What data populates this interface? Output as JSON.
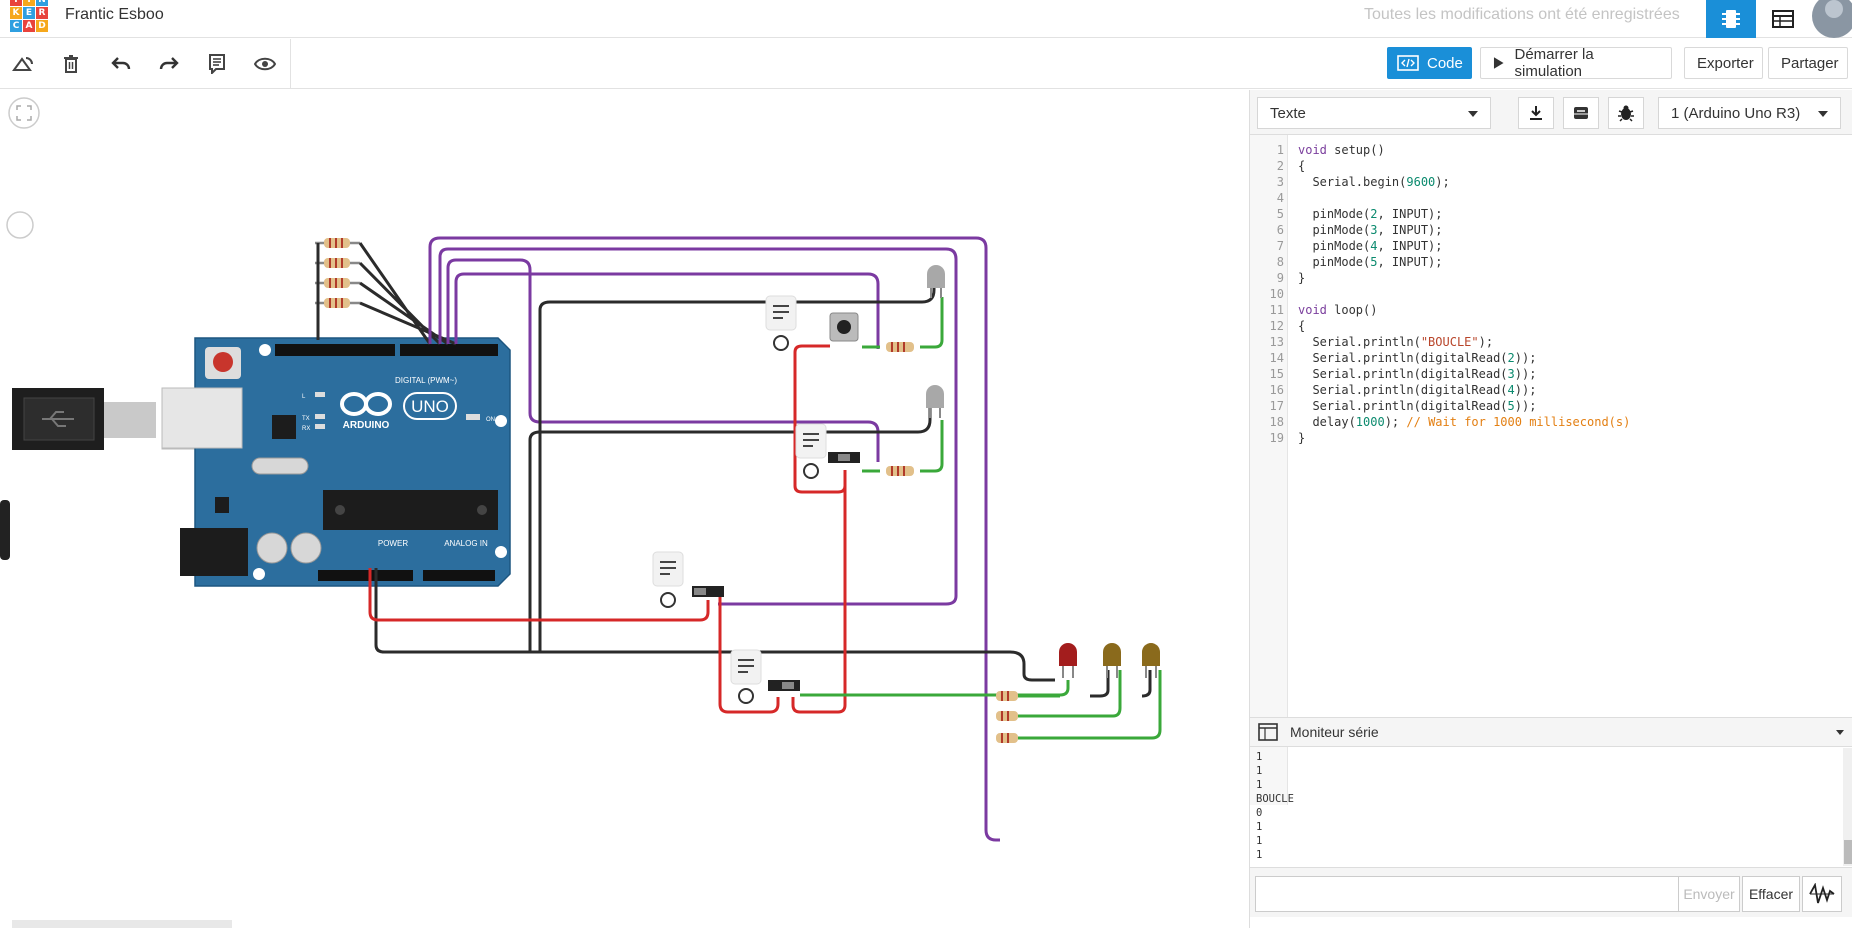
{
  "app": {
    "project_title": "Frantic Esboo",
    "save_status": "Toutes les modifications ont été enregistrées",
    "logo_letters": [
      "T",
      "I",
      "N",
      "K",
      "E",
      "R",
      "C",
      "A",
      "D"
    ]
  },
  "toolbar": {
    "code_label": "Code",
    "start_simulation_label": "Démarrer la simulation",
    "export_label": "Exporter",
    "share_label": "Partager"
  },
  "code_panel": {
    "mode_select": "Texte",
    "device_select": "1 (Arduino Uno R3)",
    "lines": [
      {
        "n": "1",
        "text": "void setup()"
      },
      {
        "n": "2",
        "text": "{"
      },
      {
        "n": "3",
        "text": "  Serial.begin(9600);"
      },
      {
        "n": "4",
        "text": ""
      },
      {
        "n": "5",
        "text": "  pinMode(2, INPUT);"
      },
      {
        "n": "6",
        "text": "  pinMode(3, INPUT);"
      },
      {
        "n": "7",
        "text": "  pinMode(4, INPUT);"
      },
      {
        "n": "8",
        "text": "  pinMode(5, INPUT);"
      },
      {
        "n": "9",
        "text": "}"
      },
      {
        "n": "10",
        "text": ""
      },
      {
        "n": "11",
        "text": "void loop()"
      },
      {
        "n": "12",
        "text": "{"
      },
      {
        "n": "13",
        "text": "  Serial.println(\"BOUCLE\");"
      },
      {
        "n": "14",
        "text": "  Serial.println(digitalRead(2));"
      },
      {
        "n": "15",
        "text": "  Serial.println(digitalRead(3));"
      },
      {
        "n": "16",
        "text": "  Serial.println(digitalRead(4));"
      },
      {
        "n": "17",
        "text": "  Serial.println(digitalRead(5));"
      },
      {
        "n": "18",
        "text": "  delay(1000); // Wait for 1000 millisecond(s)"
      },
      {
        "n": "19",
        "text": "}"
      }
    ]
  },
  "serial_monitor": {
    "title": "Moniteur série",
    "output": [
      "1",
      "1",
      "1",
      "BOUCLE",
      "0",
      "1",
      "1",
      "1"
    ],
    "send_label": "Envoyer",
    "clear_label": "Effacer"
  },
  "board": {
    "brand": "ARDUINO",
    "model": "UNO",
    "digital_label": "DIGITAL (PWM~)",
    "power_label": "POWER",
    "analog_label": "ANALOG IN",
    "on_label": "ON",
    "aref_label": "AREF",
    "gnd_label": "GND",
    "tx_label": "TX",
    "rx_label": "RX",
    "l_label": "L"
  },
  "colors": {
    "accent": "#1a8fd8",
    "board": "#2c6e9e",
    "wire_purple": "#7b3aa1",
    "wire_red": "#d62828",
    "wire_black": "#2b2b2b",
    "wire_green": "#3aa83a",
    "led_red": "#a31d1d",
    "led_yellow": "#8a6a1c"
  }
}
